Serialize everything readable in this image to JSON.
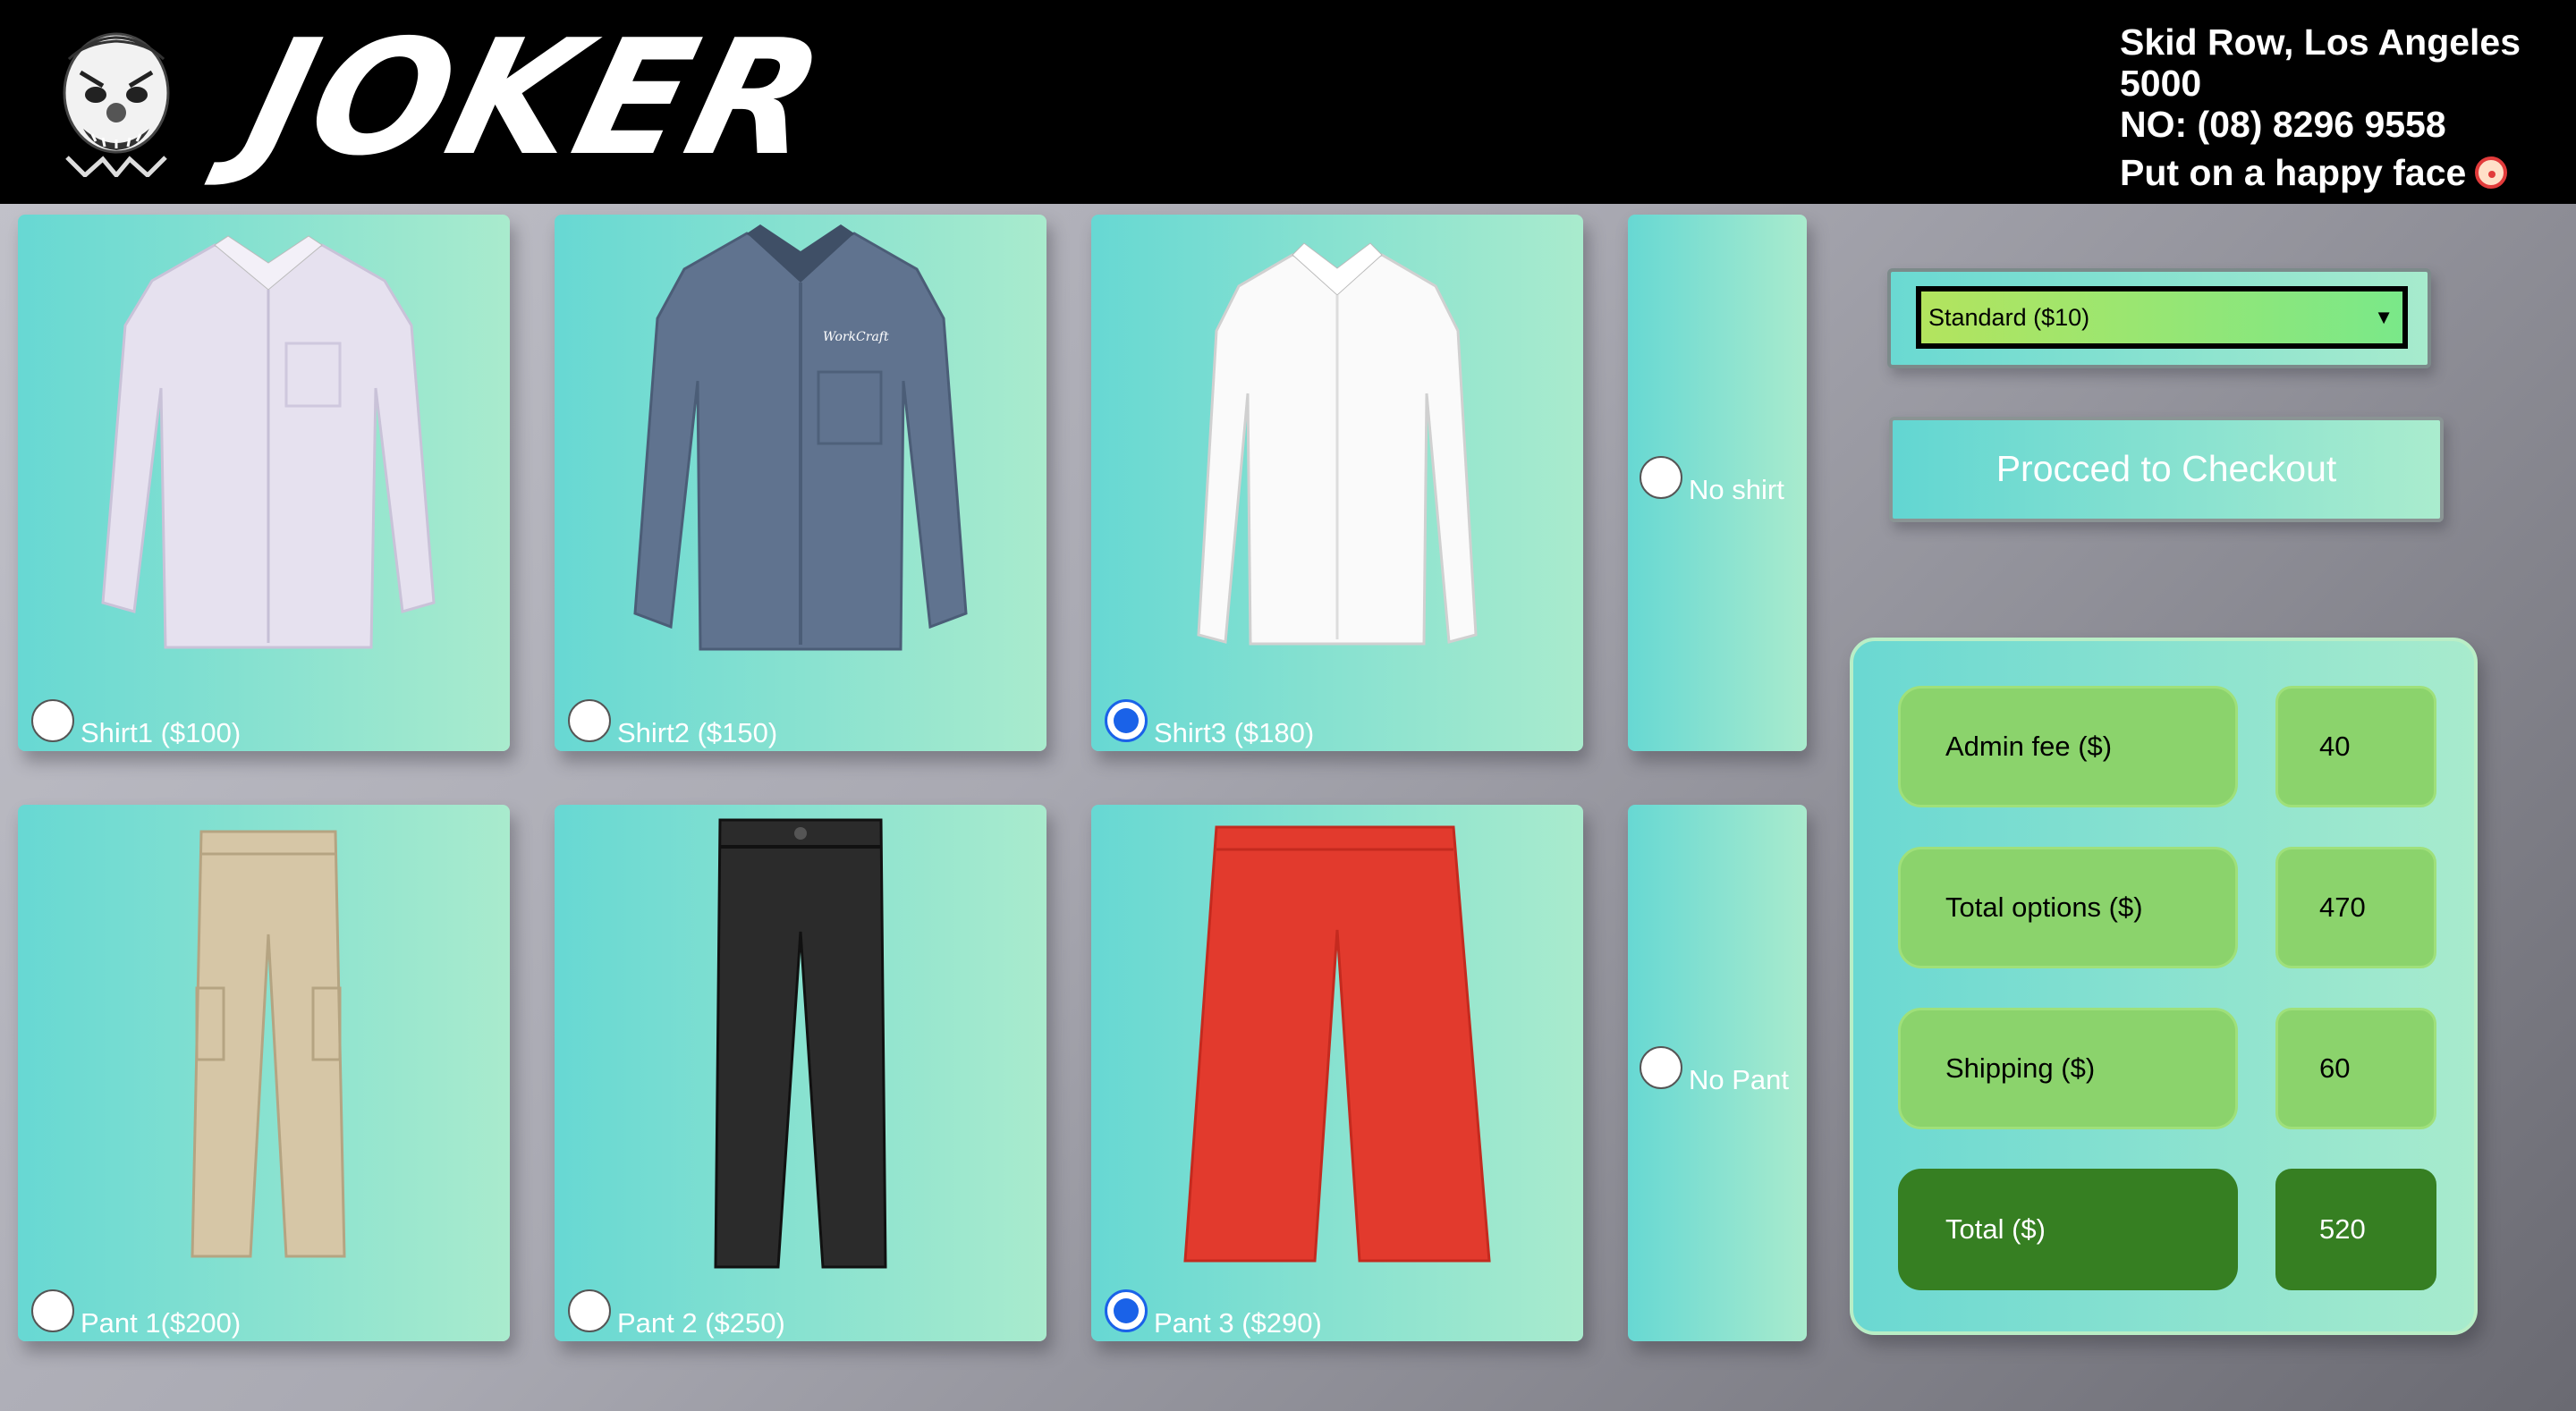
{
  "header": {
    "brand": "JOKER",
    "address": "Skid Row, Los Angeles",
    "postcode": "5000",
    "phone": "NO: (08) 8296 9558",
    "tagline": "Put on a happy face"
  },
  "shirts": [
    {
      "label": "Shirt1 ($100)",
      "selected": false,
      "image": "lavender-dress-shirt"
    },
    {
      "label": "Shirt2 ($150)",
      "selected": false,
      "image": "blue-chambray-shirt"
    },
    {
      "label": "Shirt3 ($180)",
      "selected": true,
      "image": "white-dress-shirt"
    },
    {
      "label": "No shirt",
      "selected": false
    }
  ],
  "pants": [
    {
      "label": "Pant 1($200)",
      "selected": false,
      "image": "khaki-cargo-pants"
    },
    {
      "label": "Pant 2 ($250)",
      "selected": false,
      "image": "black-pants"
    },
    {
      "label": "Pant 3 ($290)",
      "selected": true,
      "image": "red-flared-pants"
    },
    {
      "label": "No Pant",
      "selected": false
    }
  ],
  "shipping_select": {
    "value": "Standard ($10)"
  },
  "checkout_label": "Procced to Checkout",
  "summary": {
    "admin_label": "Admin fee ($)",
    "admin_value": "40",
    "options_label": "Total options ($)",
    "options_value": "470",
    "shipping_label": "Shipping ($)",
    "shipping_value": "60",
    "total_label": "Total ($)",
    "total_value": "520"
  },
  "colors": {
    "accent": "#1a62e8",
    "total_bg": "#367f22",
    "row_bg": "#8bd36c",
    "card_start": "#67d8d3",
    "card_end": "#a9ebcd"
  }
}
